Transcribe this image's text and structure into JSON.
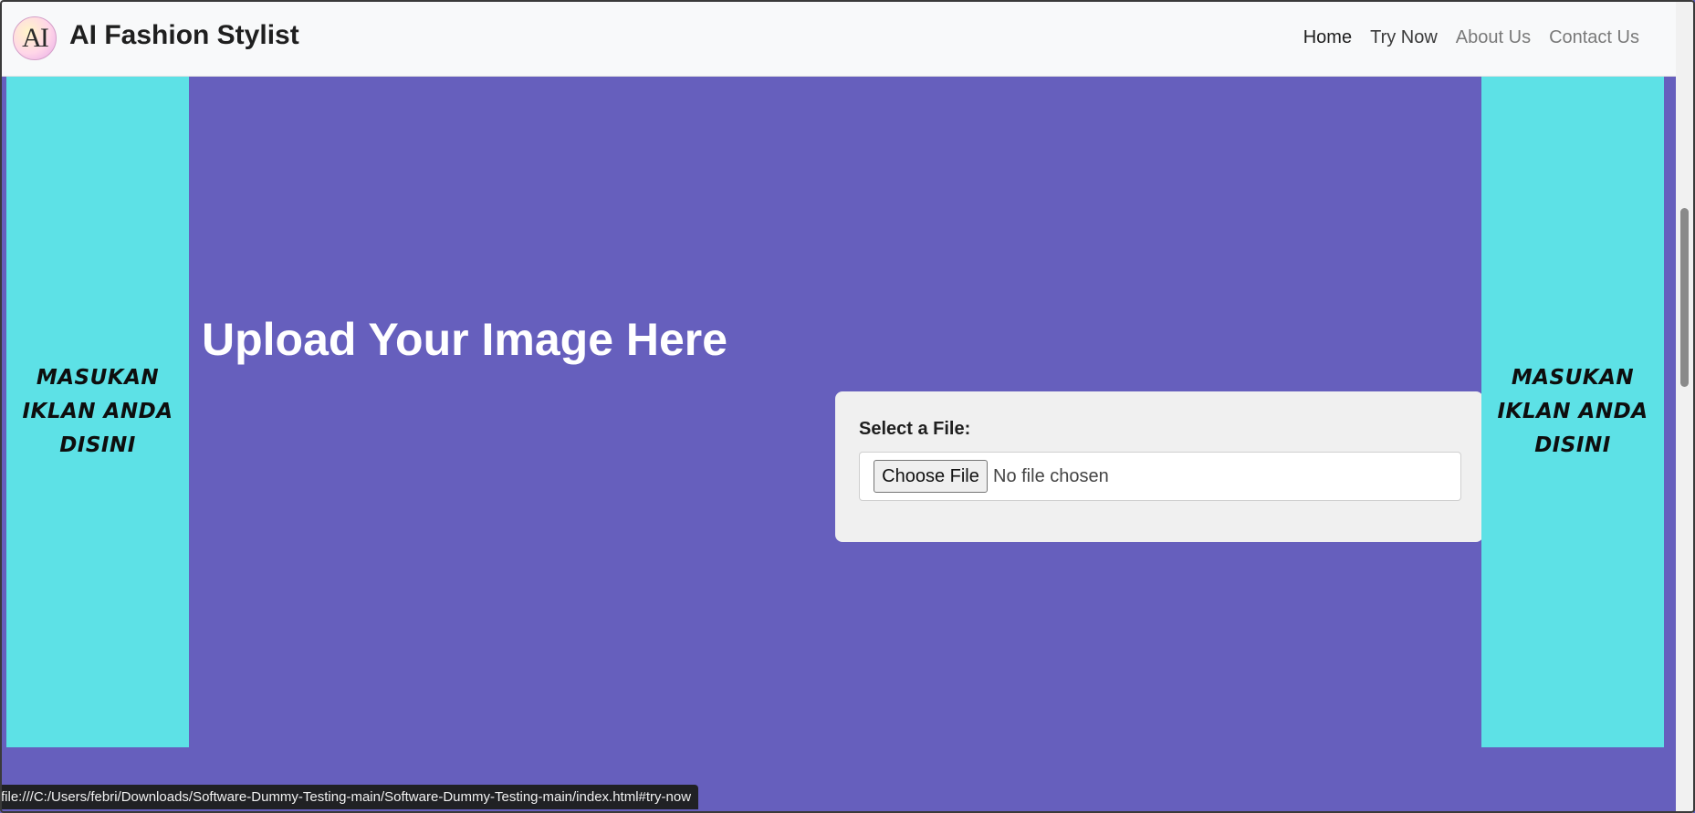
{
  "brand": {
    "logo_text": "AI",
    "name": "AI Fashion Stylist"
  },
  "nav": {
    "items": [
      {
        "label": "Home"
      },
      {
        "label": "Try Now"
      },
      {
        "label": "About Us"
      },
      {
        "label": "Contact Us"
      }
    ]
  },
  "ads": {
    "left_text": "MASUKAN IKLAN ANDA DISINI",
    "right_text": "MASUKAN IKLAN ANDA DISINI"
  },
  "main": {
    "headline": "Upload Your Image Here"
  },
  "upload_form": {
    "label": "Select a File:",
    "button_label": "Choose File",
    "status": "No file chosen"
  },
  "status_bar": {
    "url": "file:///C:/Users/febri/Downloads/Software-Dummy-Testing-main/Software-Dummy-Testing-main/index.html#try-now"
  },
  "colors": {
    "page_bg": "#665fbd",
    "ad_bg": "#5de1e6",
    "navbar_bg": "#f8f9fa",
    "card_bg": "#f0f0f0"
  }
}
